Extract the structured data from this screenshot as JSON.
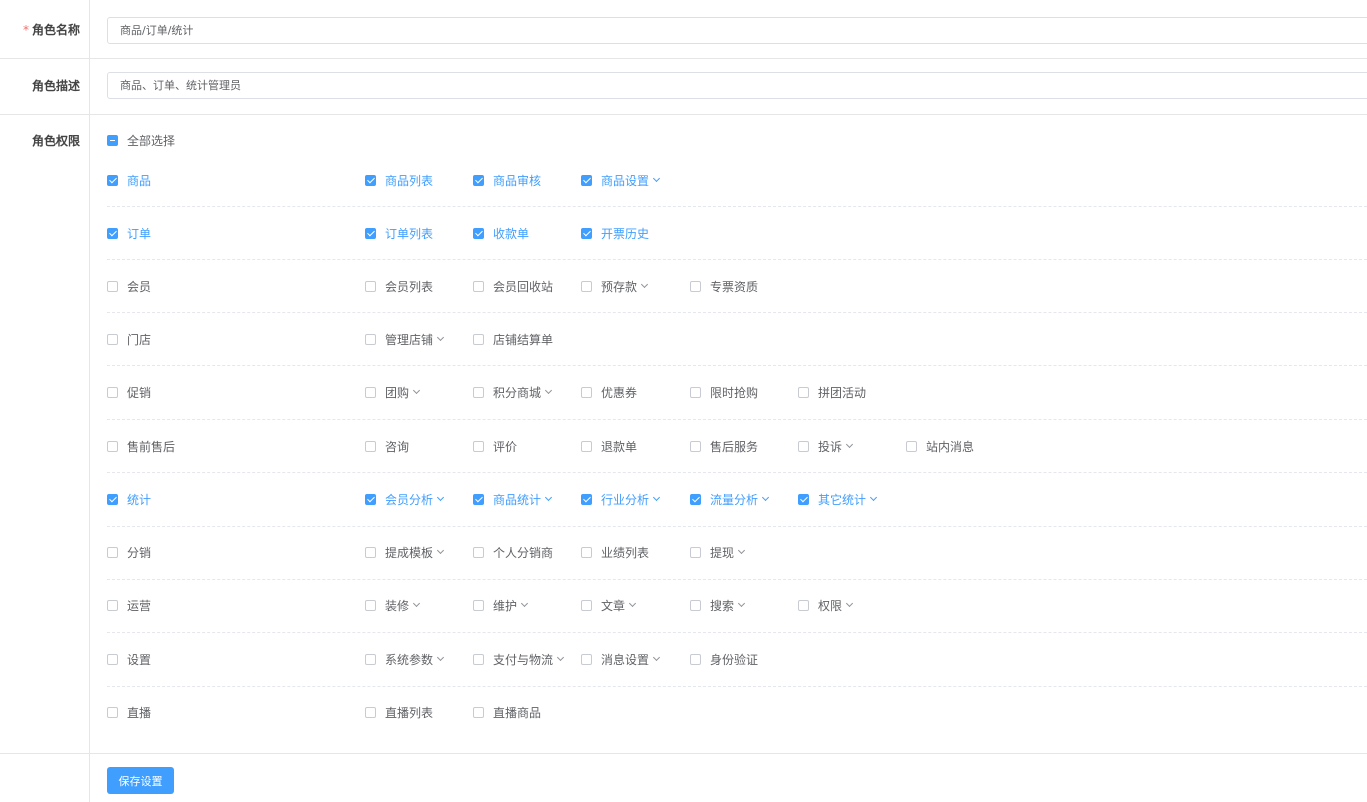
{
  "form": {
    "name_label": "角色名称",
    "name_required_mark": "*",
    "name_value": "商品/订单/统计",
    "desc_label": "角色描述",
    "desc_value": "商品、订单、统计管理员",
    "perm_label": "角色权限",
    "select_all_label": "全部选择",
    "save_label": "保存设置"
  },
  "colors": {
    "accent": "#409eff",
    "border": "#dcdfe6",
    "text": "#606266"
  },
  "permissions": [
    {
      "label": "商品",
      "checked": true,
      "children": [
        {
          "label": "商品列表",
          "checked": true,
          "dropdown": false
        },
        {
          "label": "商品审核",
          "checked": true,
          "dropdown": false
        },
        {
          "label": "商品设置",
          "checked": true,
          "dropdown": true
        }
      ]
    },
    {
      "label": "订单",
      "checked": true,
      "children": [
        {
          "label": "订单列表",
          "checked": true,
          "dropdown": false
        },
        {
          "label": "收款单",
          "checked": true,
          "dropdown": false
        },
        {
          "label": "开票历史",
          "checked": true,
          "dropdown": false
        }
      ]
    },
    {
      "label": "会员",
      "checked": false,
      "children": [
        {
          "label": "会员列表",
          "checked": false,
          "dropdown": false
        },
        {
          "label": "会员回收站",
          "checked": false,
          "dropdown": false
        },
        {
          "label": "预存款",
          "checked": false,
          "dropdown": true
        },
        {
          "label": "专票资质",
          "checked": false,
          "dropdown": false
        }
      ]
    },
    {
      "label": "门店",
      "checked": false,
      "children": [
        {
          "label": "管理店铺",
          "checked": false,
          "dropdown": true
        },
        {
          "label": "店铺结算单",
          "checked": false,
          "dropdown": false
        }
      ]
    },
    {
      "label": "促销",
      "checked": false,
      "children": [
        {
          "label": "团购",
          "checked": false,
          "dropdown": true
        },
        {
          "label": "积分商城",
          "checked": false,
          "dropdown": true
        },
        {
          "label": "优惠券",
          "checked": false,
          "dropdown": false
        },
        {
          "label": "限时抢购",
          "checked": false,
          "dropdown": false
        },
        {
          "label": "拼团活动",
          "checked": false,
          "dropdown": false
        }
      ]
    },
    {
      "label": "售前售后",
      "checked": false,
      "children": [
        {
          "label": "咨询",
          "checked": false,
          "dropdown": false
        },
        {
          "label": "评价",
          "checked": false,
          "dropdown": false
        },
        {
          "label": "退款单",
          "checked": false,
          "dropdown": false
        },
        {
          "label": "售后服务",
          "checked": false,
          "dropdown": false
        },
        {
          "label": "投诉",
          "checked": false,
          "dropdown": true
        },
        {
          "label": "站内消息",
          "checked": false,
          "dropdown": false
        }
      ]
    },
    {
      "label": "统计",
      "checked": true,
      "children": [
        {
          "label": "会员分析",
          "checked": true,
          "dropdown": true
        },
        {
          "label": "商品统计",
          "checked": true,
          "dropdown": true
        },
        {
          "label": "行业分析",
          "checked": true,
          "dropdown": true
        },
        {
          "label": "流量分析",
          "checked": true,
          "dropdown": true
        },
        {
          "label": "其它统计",
          "checked": true,
          "dropdown": true
        }
      ]
    },
    {
      "label": "分销",
      "checked": false,
      "children": [
        {
          "label": "提成模板",
          "checked": false,
          "dropdown": true
        },
        {
          "label": "个人分销商",
          "checked": false,
          "dropdown": false
        },
        {
          "label": "业绩列表",
          "checked": false,
          "dropdown": false
        },
        {
          "label": "提现",
          "checked": false,
          "dropdown": true
        }
      ]
    },
    {
      "label": "运营",
      "checked": false,
      "children": [
        {
          "label": "装修",
          "checked": false,
          "dropdown": true
        },
        {
          "label": "维护",
          "checked": false,
          "dropdown": true
        },
        {
          "label": "文章",
          "checked": false,
          "dropdown": true
        },
        {
          "label": "搜索",
          "checked": false,
          "dropdown": true
        },
        {
          "label": "权限",
          "checked": false,
          "dropdown": true
        }
      ]
    },
    {
      "label": "设置",
      "checked": false,
      "children": [
        {
          "label": "系统参数",
          "checked": false,
          "dropdown": true
        },
        {
          "label": "支付与物流",
          "checked": false,
          "dropdown": true
        },
        {
          "label": "消息设置",
          "checked": false,
          "dropdown": true
        },
        {
          "label": "身份验证",
          "checked": false,
          "dropdown": false
        }
      ]
    },
    {
      "label": "直播",
      "checked": false,
      "children": [
        {
          "label": "直播列表",
          "checked": false,
          "dropdown": false
        },
        {
          "label": "直播商品",
          "checked": false,
          "dropdown": false
        }
      ]
    }
  ]
}
